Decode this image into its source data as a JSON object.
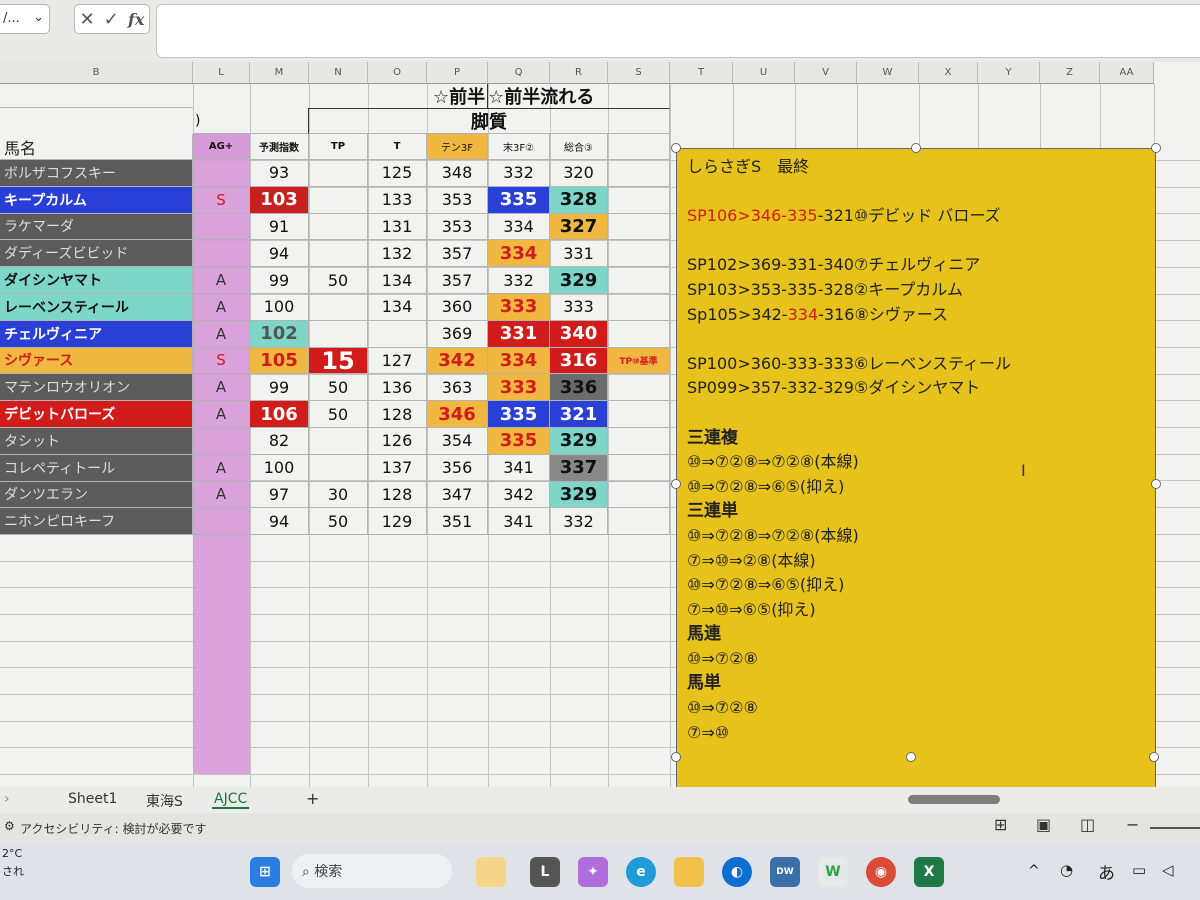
{
  "formula_bar": {
    "namebox": "/...",
    "cancel": "✕",
    "confirm": "✓",
    "fx": "fx"
  },
  "columns": [
    "B",
    "L",
    "M",
    "N",
    "O",
    "P",
    "Q",
    "R",
    "S",
    "T",
    "U",
    "V",
    "W",
    "X",
    "Y",
    "Z",
    "AA"
  ],
  "header": {
    "title_left": "☆前半",
    "title_right": "☆前半流れる",
    "paren": ")",
    "kyakushitsu": "脚質",
    "horse_name": "馬名",
    "ag": "AG+",
    "yosoku": "予測指数",
    "tp": "TP",
    "t": "T",
    "ten3f": "テン3F",
    "matsu3f": "末3F②",
    "sogo": "総合③"
  },
  "rows": [
    {
      "name": "ボルザコフスキー",
      "ag": "",
      "idx": "93",
      "tp": "",
      "t": "125",
      "ten": "348",
      "matsu": "332",
      "sogo": "320",
      "note": ""
    },
    {
      "name": "キープカルム",
      "ag": "S",
      "idx": "103",
      "tp": "",
      "t": "133",
      "ten": "353",
      "matsu": "335",
      "sogo": "328",
      "note": ""
    },
    {
      "name": "ラケマーダ",
      "ag": "",
      "idx": "91",
      "tp": "",
      "t": "131",
      "ten": "353",
      "matsu": "334",
      "sogo": "327",
      "note": ""
    },
    {
      "name": "ダディーズビビッド",
      "ag": "",
      "idx": "94",
      "tp": "",
      "t": "132",
      "ten": "357",
      "matsu": "334",
      "sogo": "331",
      "note": ""
    },
    {
      "name": "ダイシンヤマト",
      "ag": "A",
      "idx": "99",
      "tp": "50",
      "t": "134",
      "ten": "357",
      "matsu": "332",
      "sogo": "329",
      "note": ""
    },
    {
      "name": "レーベンスティール",
      "ag": "A",
      "idx": "100",
      "tp": "",
      "t": "134",
      "ten": "360",
      "matsu": "333",
      "sogo": "333",
      "note": ""
    },
    {
      "name": "チェルヴィニア",
      "ag": "A",
      "idx": "102",
      "tp": "",
      "t": "",
      "ten": "369",
      "matsu": "331",
      "sogo": "340",
      "note": ""
    },
    {
      "name": "シヴァース",
      "ag": "S",
      "idx": "105",
      "tp": "15",
      "t": "127",
      "ten": "342",
      "matsu": "334",
      "sogo": "316",
      "note": "TP⑩基準"
    },
    {
      "name": "マテンロウオリオン",
      "ag": "A",
      "idx": "99",
      "tp": "50",
      "t": "136",
      "ten": "363",
      "matsu": "333",
      "sogo": "336",
      "note": ""
    },
    {
      "name": "デビットバローズ",
      "ag": "A",
      "idx": "106",
      "tp": "50",
      "t": "128",
      "ten": "346",
      "matsu": "335",
      "sogo": "321",
      "note": ""
    },
    {
      "name": "タシット",
      "ag": "",
      "idx": "82",
      "tp": "",
      "t": "126",
      "ten": "354",
      "matsu": "335",
      "sogo": "329",
      "note": ""
    },
    {
      "name": "コレペティトール",
      "ag": "A",
      "idx": "100",
      "tp": "",
      "t": "137",
      "ten": "356",
      "matsu": "341",
      "sogo": "337",
      "note": ""
    },
    {
      "name": "ダンツエラン",
      "ag": "A",
      "idx": "97",
      "tp": "30",
      "t": "128",
      "ten": "347",
      "matsu": "342",
      "sogo": "329",
      "note": ""
    },
    {
      "name": "ニホンピロキーフ",
      "ag": "",
      "idx": "94",
      "tp": "50",
      "t": "129",
      "ten": "351",
      "matsu": "341",
      "sogo": "332",
      "note": ""
    }
  ],
  "textbox": {
    "title": "しらさぎS　最終",
    "sp1_a": "SP106>346-",
    "sp1_b": "335",
    "sp1_c": "-321",
    "sp1_d": "⑩デビッド バローズ",
    "sp2": "SP102>369-331-340⑦チェルヴィニア",
    "sp3": "SP103>353-335-328②キープカルム",
    "sp4_a": "Sp105>342-",
    "sp4_b": "334",
    "sp4_c": "-316⑧シヴァース",
    "sp5": "SP100>360-333-333⑥レーベンスティール",
    "sp6": "SP099>357-332-329⑤ダイシンヤマト",
    "h_sanrenpuku": "三連複",
    "sf1": "⑩⇒⑦②⑧⇒⑦②⑧(本線)",
    "sf2": "⑩⇒⑦②⑧⇒⑥⑤(抑え)",
    "h_sanrentan": "三連単",
    "st1": "⑩⇒⑦②⑧⇒⑦②⑧(本線)",
    "st2": "⑦⇒⑩⇒②⑧(本線)",
    "st3": "⑩⇒⑦②⑧⇒⑥⑤(抑え)",
    "st4": "⑦⇒⑩⇒⑥⑤(抑え)",
    "h_umaren": "馬連",
    "ur1": "⑩⇒⑦②⑧",
    "h_umatan": "馬単",
    "ut1": "⑩⇒⑦②⑧",
    "ut2": "⑦⇒⑩"
  },
  "tabs": {
    "sheet1": "Sheet1",
    "tokai": "東海S",
    "ajcc": "AJCC",
    "add": "+"
  },
  "status": {
    "accessibility": "アクセシビリティ: 検討が必要です"
  },
  "taskbar": {
    "temp": "2°C",
    "weather": "され",
    "search": "検索",
    "ime": "あ"
  },
  "colors": {
    "yellow_box": "#e6c21a",
    "blue": "#2a3fd6",
    "red": "#d21c1c",
    "teal": "#7ed6c8",
    "orange": "#f0a830",
    "gray": "#6b6b6b",
    "purple": "#d79ad8"
  }
}
